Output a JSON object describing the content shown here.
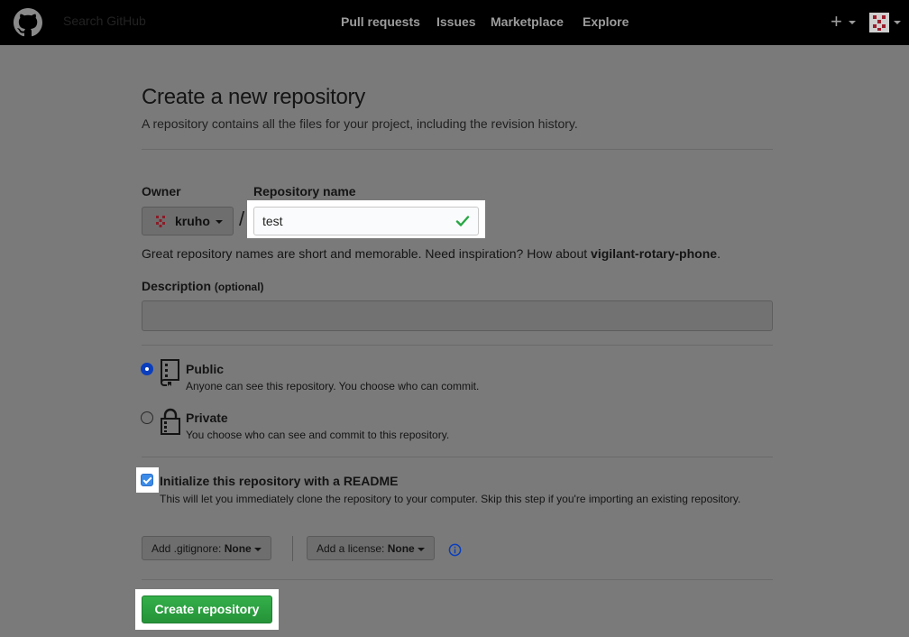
{
  "header": {
    "search_placeholder": "Search GitHub",
    "nav": [
      "Pull requests",
      "Issues",
      "Marketplace",
      "Explore"
    ],
    "plus": "+"
  },
  "page": {
    "title": "Create a new repository",
    "subtitle": "A repository contains all the files for your project, including the revision history."
  },
  "owner": {
    "label": "Owner",
    "value": "kruho"
  },
  "repo": {
    "label": "Repository name",
    "value": "test",
    "slash": "/"
  },
  "hint": {
    "text": "Great repository names are short and memorable. Need inspiration? How about ",
    "suggestion": "vigilant-rotary-phone",
    "end": "."
  },
  "description": {
    "label": "Description",
    "optional": "(optional)",
    "value": ""
  },
  "visibility": {
    "public": {
      "title": "Public",
      "desc": "Anyone can see this repository. You choose who can commit.",
      "selected": true
    },
    "private": {
      "title": "Private",
      "desc": "You choose who can see and commit to this repository.",
      "selected": false
    }
  },
  "init": {
    "checked": true,
    "title": "Initialize this repository with a README",
    "desc": "This will let you immediately clone the repository to your computer. Skip this step if you're importing an existing repository."
  },
  "gitignore": {
    "label": "Add .gitignore:",
    "value": "None"
  },
  "license": {
    "label": "Add a license:",
    "value": "None"
  },
  "create_button": "Create repository",
  "colors": {
    "accent_green": "#28a745",
    "radio_blue": "#0a3ebd",
    "check_green": "#28a745"
  }
}
